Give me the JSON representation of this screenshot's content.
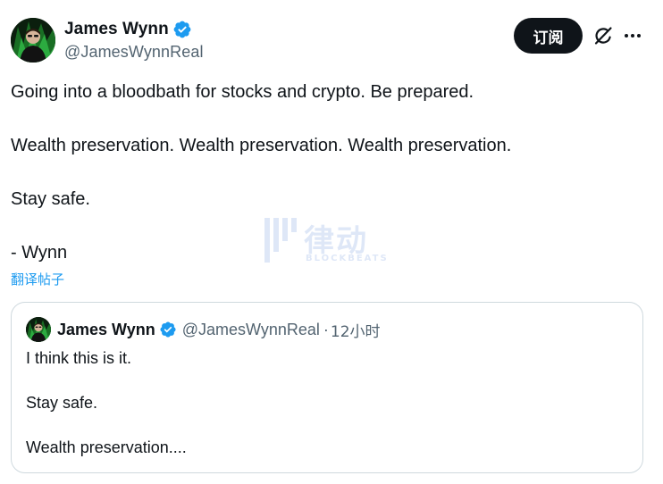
{
  "author": {
    "display_name": "James Wynn",
    "handle": "@JamesWynnReal",
    "verified_color": "#1d9bf0"
  },
  "actions": {
    "subscribe_label": "订阅",
    "grok_icon": "grok-icon",
    "more_icon": "more-icon"
  },
  "tweet": {
    "lines": [
      "Going into a bloodbath for stocks and crypto. Be prepared.",
      "Wealth preservation. Wealth preservation. Wealth preservation.",
      "Stay safe.",
      "- Wynn"
    ],
    "translate_label": "翻译帖子"
  },
  "watermark": {
    "cn": "律动",
    "en": "BLOCKBEATS"
  },
  "quote": {
    "display_name": "James Wynn",
    "handle": "@JamesWynnReal",
    "separator": "·",
    "time": "12小时",
    "lines": [
      "I think this is it.",
      "Stay safe.",
      "Wealth preservation...."
    ]
  },
  "colors": {
    "text_primary": "#0f1419",
    "text_secondary": "#536471",
    "accent_blue": "#1d9bf0",
    "border": "#cfd9de",
    "button_dark": "#0f1419"
  }
}
